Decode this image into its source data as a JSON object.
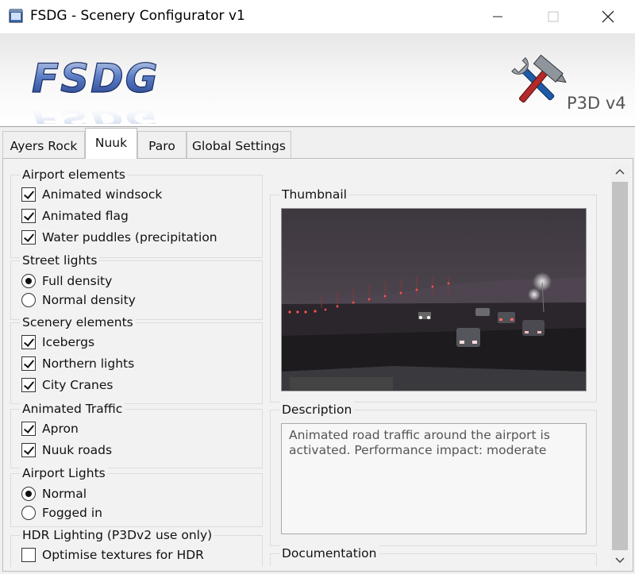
{
  "window": {
    "title": "FSDG - Scenery Configurator v1"
  },
  "banner": {
    "logo_text": "FSDG",
    "version_badge": "P3D v4"
  },
  "tabs": [
    {
      "label": "Ayers Rock"
    },
    {
      "label": "Nuuk"
    },
    {
      "label": "Paro"
    },
    {
      "label": "Global Settings"
    }
  ],
  "groups": {
    "airport_elements": {
      "title": "Airport elements",
      "options": [
        {
          "label": "Animated windsock",
          "checked": true
        },
        {
          "label": "Animated flag",
          "checked": true
        },
        {
          "label": "Water puddles (precipitation",
          "checked": true
        }
      ]
    },
    "street_lights": {
      "title": "Street lights",
      "options": [
        {
          "label": "Full density",
          "selected": true
        },
        {
          "label": "Normal density",
          "selected": false
        }
      ]
    },
    "scenery_elements": {
      "title": "Scenery elements",
      "options": [
        {
          "label": "Icebergs",
          "checked": true
        },
        {
          "label": "Northern lights",
          "checked": true
        },
        {
          "label": "City Cranes",
          "checked": true
        }
      ]
    },
    "animated_traffic": {
      "title": "Animated Traffic",
      "options": [
        {
          "label": "Apron",
          "checked": true
        },
        {
          "label": "Nuuk roads",
          "checked": true
        }
      ]
    },
    "airport_lights": {
      "title": "Airport Lights",
      "options": [
        {
          "label": "Normal",
          "selected": true
        },
        {
          "label": "Fogged in",
          "selected": false
        }
      ]
    },
    "hdr_lighting": {
      "title": "HDR Lighting (P3Dv2 use only)",
      "options": [
        {
          "label": "Optimise textures for HDR",
          "checked": false
        }
      ]
    }
  },
  "right": {
    "thumbnail_title": "Thumbnail",
    "description_title": "Description",
    "description_text": "Animated road traffic around the airport is activated. Performance impact: moderate",
    "documentation_title": "Documentation"
  },
  "colors": {
    "accent_blue": "#2e4fa8",
    "tool_red": "#b22a2a",
    "tool_blue": "#1e5aa8"
  }
}
